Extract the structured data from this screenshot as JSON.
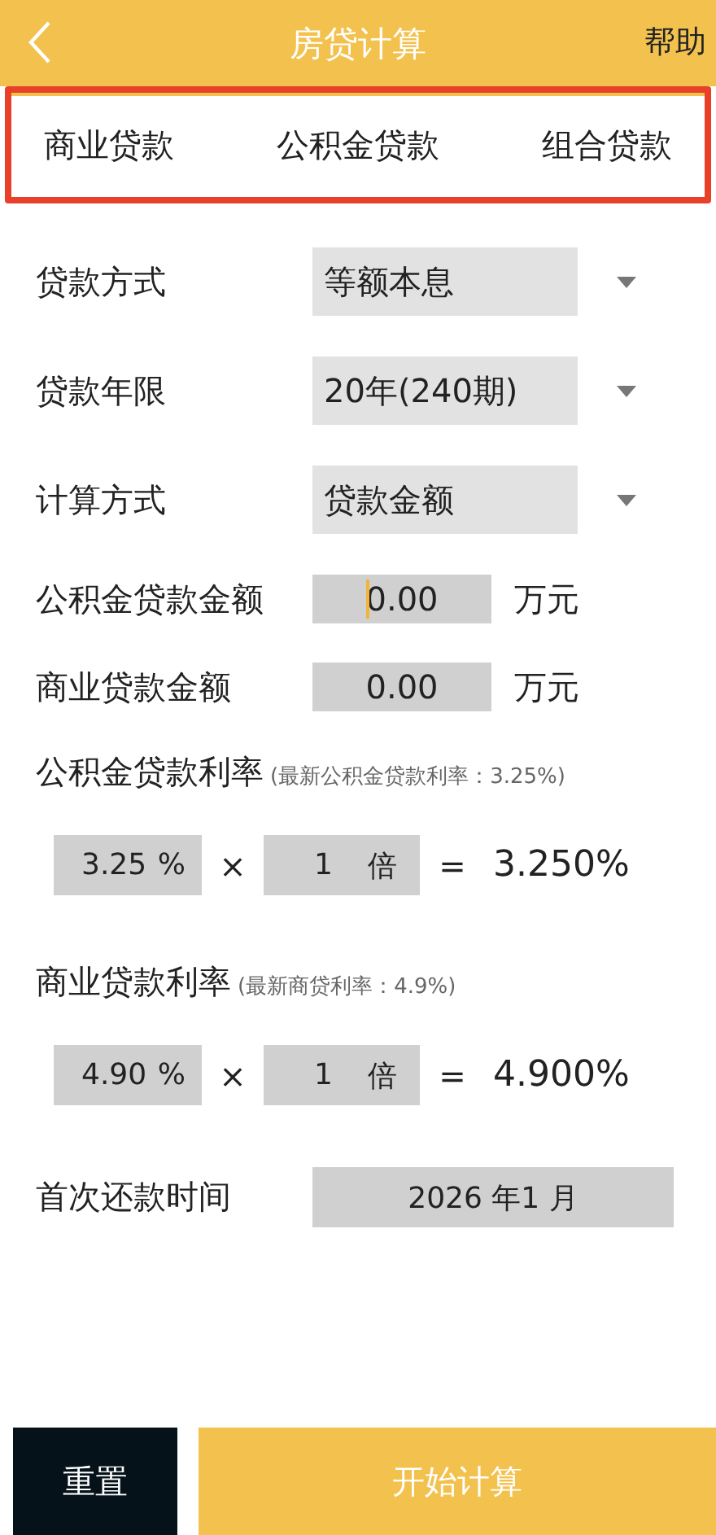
{
  "header": {
    "title": "房贷计算",
    "action": "帮助"
  },
  "tabs": [
    {
      "label": "商业贷款"
    },
    {
      "label": "公积金贷款"
    },
    {
      "label": "组合贷款"
    }
  ],
  "selects": [
    {
      "label": "贷款方式",
      "value": "等额本息"
    },
    {
      "label": "贷款年限",
      "value": "20年(240期)"
    },
    {
      "label": "计算方式",
      "value": "贷款金额"
    }
  ],
  "amounts": [
    {
      "label": "公积金贷款金额",
      "value": "0.00",
      "unit": "万元",
      "focused": true
    },
    {
      "label": "商业贷款金额",
      "value": "0.00",
      "unit": "万元",
      "focused": false
    }
  ],
  "rates": [
    {
      "title": "公积金贷款利率",
      "hint": "(最新公积金贷款利率：3.25%)",
      "rate": "3.25",
      "rate_unit": "%",
      "times_sign": "×",
      "multiple": "1",
      "multiple_unit": "倍",
      "equals": "=",
      "result": "3.250%"
    },
    {
      "title": "商业贷款利率",
      "hint": "(最新商贷利率：4.9%)",
      "rate": "4.90",
      "rate_unit": "%",
      "times_sign": "×",
      "multiple": "1",
      "multiple_unit": "倍",
      "equals": "=",
      "result": "4.900%"
    }
  ],
  "first_payment": {
    "label": "首次还款时间",
    "value": "2026 年1 月"
  },
  "buttons": [
    {
      "label": "重置",
      "kind": "secondary"
    },
    {
      "label": "开始计算",
      "kind": "primary"
    }
  ]
}
